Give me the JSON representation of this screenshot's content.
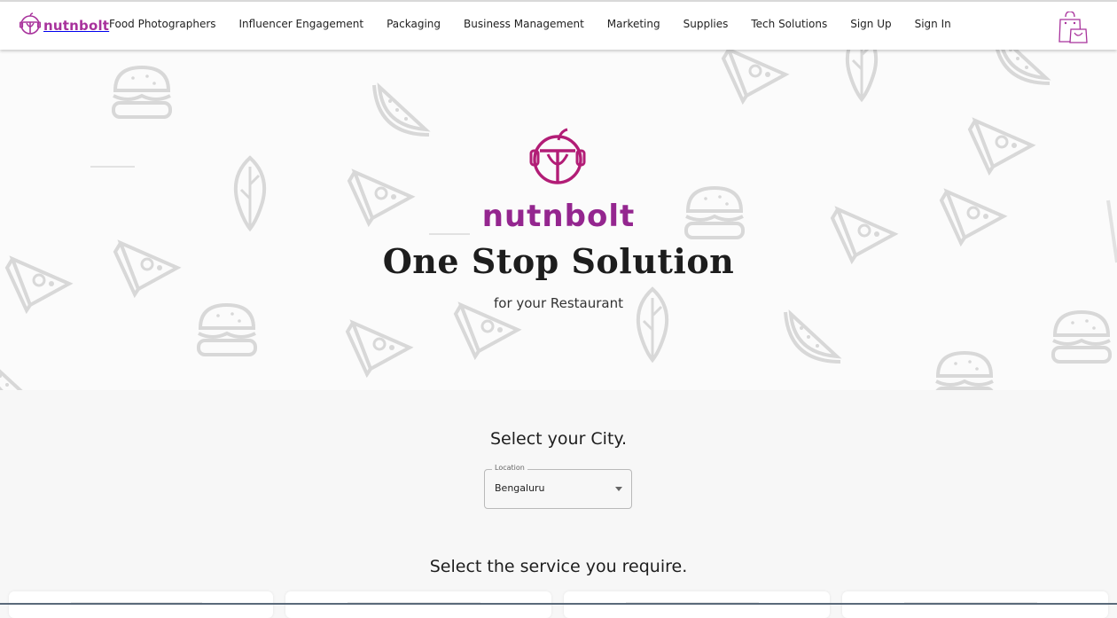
{
  "brand": {
    "name": "nutnbolt",
    "color": "#a8329c",
    "hero_color": "#94268f"
  },
  "nav": {
    "items": [
      {
        "label": "Food Photographers"
      },
      {
        "label": "Influencer Engagement"
      },
      {
        "label": "Packaging"
      },
      {
        "label": "Business Management"
      },
      {
        "label": "Marketing"
      },
      {
        "label": "Supplies"
      },
      {
        "label": "Tech Solutions"
      },
      {
        "label": "Sign Up"
      },
      {
        "label": "Sign In"
      }
    ],
    "cart_icon": "shopping-bag-icon"
  },
  "hero": {
    "brand": "nutnbolt",
    "headline": "One Stop Solution",
    "subline": "for your Restaurant",
    "background_icons": [
      "burger-icon",
      "pizza-slice-icon",
      "watermelon-icon",
      "leaf-icon"
    ]
  },
  "city_section": {
    "title": "Select your City.",
    "location_label": "Location",
    "location_value": "Bengaluru"
  },
  "service_section": {
    "title": "Select the service you require."
  }
}
